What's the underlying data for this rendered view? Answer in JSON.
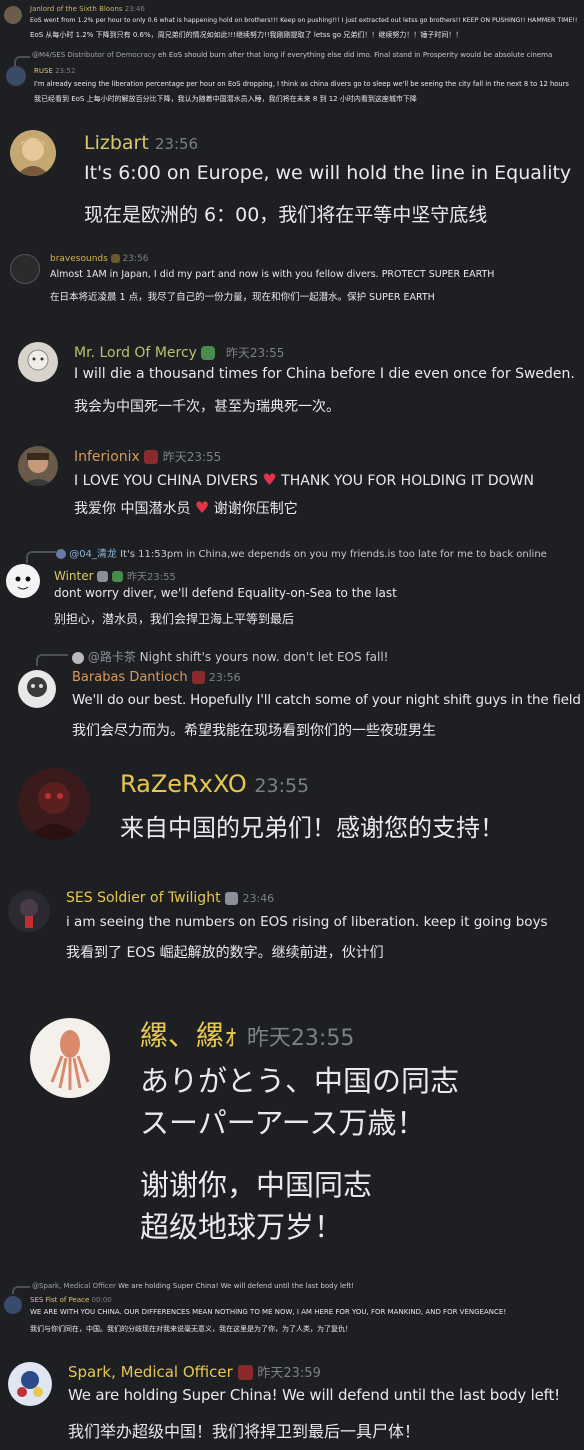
{
  "messages": {
    "m1": {
      "name": "Janlord of the Sixth Bloons",
      "time": "23:46",
      "lines": [
        "EoS went from 1.2% per hour to only 0.6 what is happening hold on brothers!!! Keep on pushing!!! I just extracted out letss go brothers!! KEEP ON PUSHING!! HAMMER TIME!!",
        "EoS 从每小时 1.2% 下降到只有 0.6%，周兄弟们的情况如如此!!!继续努力!!我刚刚提取了 letss go 兄弟们！！继续努力！！锤子时间！！"
      ]
    },
    "m2": {
      "reply_name": "@M4/SES Distributor of Democracy",
      "reply_text": "eh EoS should burn after that long if everything else did imo. Final stand in Prosperity would be absolute cinema",
      "name": "RUSE",
      "time": "23:52",
      "lines": [
        "I'm already seeing the liberation percentage per hour on EoS dropping, I think as china divers go to sleep we'll be seeing the city fall in the next 8 to 12 hours",
        "我已经看到 EoS 上每小时的解放百分比下降，我认为随着中国潜水员入睡，我们将在未来 8 到 12 小时内看到这座城市下降"
      ]
    },
    "m3": {
      "name": "Lizbart",
      "time": "23:56",
      "lines": [
        "It's 6:00 on Europe, we will hold the line in Equality",
        "现在是欧洲的 6：00，我们将在平等中坚守底线"
      ]
    },
    "m4": {
      "name": "bravesounds",
      "time": "23:56",
      "lines": [
        "Almost 1AM in Japan, I did my part and now is with you fellow divers. PROTECT SUPER EARTH",
        "在日本将近凌晨 1 点，我尽了自己的一份力量，现在和你们一起潜水。保护 SUPER EARTH"
      ]
    },
    "m5": {
      "name": "Mr. Lord Of Mercy",
      "time": "昨天23:55",
      "lines": [
        "I will die a thousand times for China before I die even once for Sweden.",
        "我会为中国死一千次，甚至为瑞典死一次。"
      ]
    },
    "m6": {
      "name": "Inferionix",
      "time": "昨天23:55",
      "line1a": "I LOVE YOU CHINA DIVERS",
      "line1b": "THANK YOU FOR HOLDING IT DOWN",
      "line2a": "我爱你 中国潜水员",
      "line2b": "谢谢你压制它"
    },
    "m7": {
      "reply_name": "@04_清龙",
      "reply_text": "It's 11:53pm in China,we depends on you my friends.is too late for me to back online",
      "name": "Winter",
      "time": "昨天23:55",
      "lines": [
        "dont worry diver, we'll defend Equality-on-Sea to the last",
        "别担心，潜水员，我们会捍卫海上平等到最后"
      ]
    },
    "m8": {
      "reply_name": "@路卡茶",
      "reply_text": "Night shift's yours now.  don't let EOS fall!",
      "name": "Barabas Dantioch",
      "time": "23:56",
      "lines": [
        "We'll do our best. Hopefully I'll catch some of your night shift guys in the field",
        "我们会尽力而为。希望我能在现场看到你们的一些夜班男生"
      ]
    },
    "m9": {
      "name": "RaZeRxXO",
      "time": "23:55",
      "lines": [
        "来自中国的兄弟们！感谢您的支持！"
      ]
    },
    "m10": {
      "name": "SES Soldier of Twilight",
      "time": "23:46",
      "lines": [
        "i am seeing the numbers on EOS rising of liberation. keep it going boys",
        "我看到了 EOS 崛起解放的数字。继续前进，伙计们"
      ]
    },
    "m11": {
      "name": "縲、縲ｫ",
      "time": "昨天23:55",
      "lines": [
        "ありがとう、中国の同志",
        "スーパーアース万歳！",
        "谢谢你，中国同志",
        "超级地球万岁！"
      ]
    },
    "m12": {
      "reply_name": "@Spark, Medical Officer",
      "reply_text": "We are holding Super China! We will defend until the last body left!",
      "name": "SES Fist of Peace",
      "time": "00:00",
      "lines": [
        "WE ARE WITH YOU CHINA. OUR DIFFERENCES MEAN NOTHING TO ME NOW, I AM HERE FOR YOU, FOR MANKIND, AND FOR VENGEANCE!",
        "我们与你们同在，中国。我们的分歧现在对我来说毫无意义，我在这里是为了你，为了人类，为了复仇！"
      ]
    },
    "m13": {
      "name": "Spark, Medical Officer",
      "time": "昨天23:59",
      "lines": [
        "We are holding Super China! We will defend until the last body left!",
        "我们举办超级中国！我们将捍卫到最后一具尸体！"
      ]
    }
  },
  "colors": {
    "background": "#1e1f22",
    "name_gold": "#d8c66a",
    "name_green": "#b5c46b",
    "name_orange": "#d89a5a",
    "name_yellow": "#e6c84f",
    "heart": "#e0344a"
  }
}
